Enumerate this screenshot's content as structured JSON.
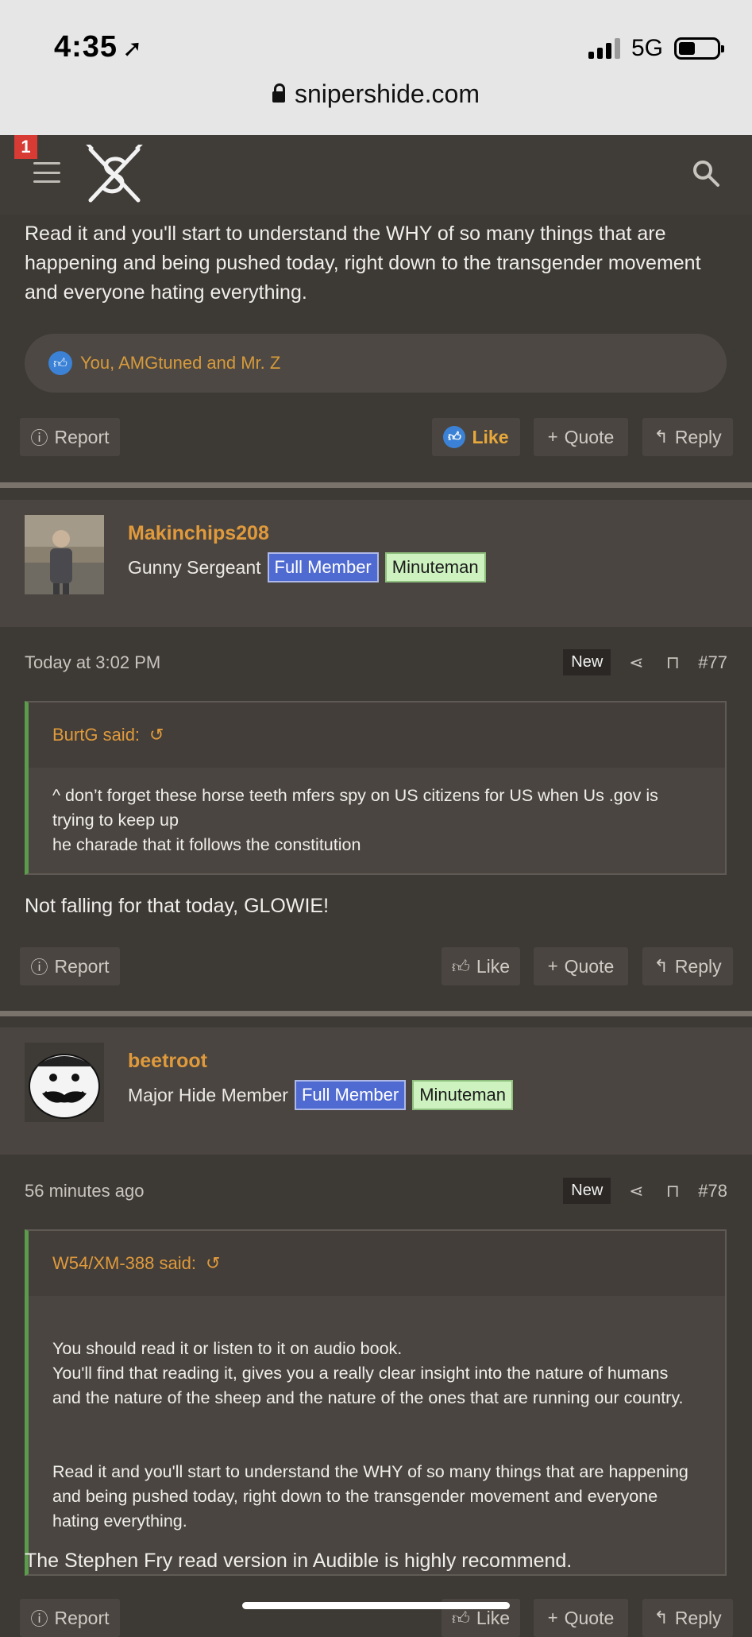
{
  "status": {
    "time": "4:35",
    "network": "5G",
    "url": "snipershide.com"
  },
  "header": {
    "notification_count": "1"
  },
  "top_post": {
    "text": "Read it and you'll start to understand the WHY of so many things that are happening and being pushed today, right down to the transgender movement and everyone hating everything.",
    "reactions": "You, AMGtuned and Mr. Z",
    "actions": {
      "report": "Report",
      "like": "Like",
      "quote": "Quote",
      "reply": "Reply"
    }
  },
  "posts": [
    {
      "username": "Makinchips208",
      "rank": "Gunny Sergeant",
      "badge1": "Full Member",
      "badge2": "Minuteman",
      "date": "Today at 3:02 PM",
      "new_label": "New",
      "post_number": "#77",
      "quote_author": "BurtG said:",
      "quote_lines": [
        "^ don’t forget these horse teeth mfers spy on US citizens for US when Us .gov is trying to keep up",
        "he charade that it follows the constitution"
      ],
      "body": "Not falling for that today, GLOWIE!",
      "actions": {
        "report": "Report",
        "like": "Like",
        "quote": "Quote",
        "reply": "Reply"
      }
    },
    {
      "username": "beetroot",
      "rank": "Major Hide Member",
      "badge1": "Full Member",
      "badge2": "Minuteman",
      "date": "56 minutes ago",
      "new_label": "New",
      "post_number": "#78",
      "quote_author": "W54/XM-388 said:",
      "quote_paragraph1": "You should read it or listen to it on audio book.\nYou'll find that reading it, gives you a really clear insight into the nature of humans and the nature of the sheep and the nature of the ones that are running our country.",
      "quote_paragraph2": "Read it and you'll start to understand the WHY of so many things that are happening and being pushed today, right down to the transgender movement and everyone hating everything.",
      "body": "The Stephen Fry read version in Audible is highly recommend.",
      "actions": {
        "report": "Report",
        "like": "Like",
        "quote": "Quote",
        "reply": "Reply"
      }
    }
  ]
}
